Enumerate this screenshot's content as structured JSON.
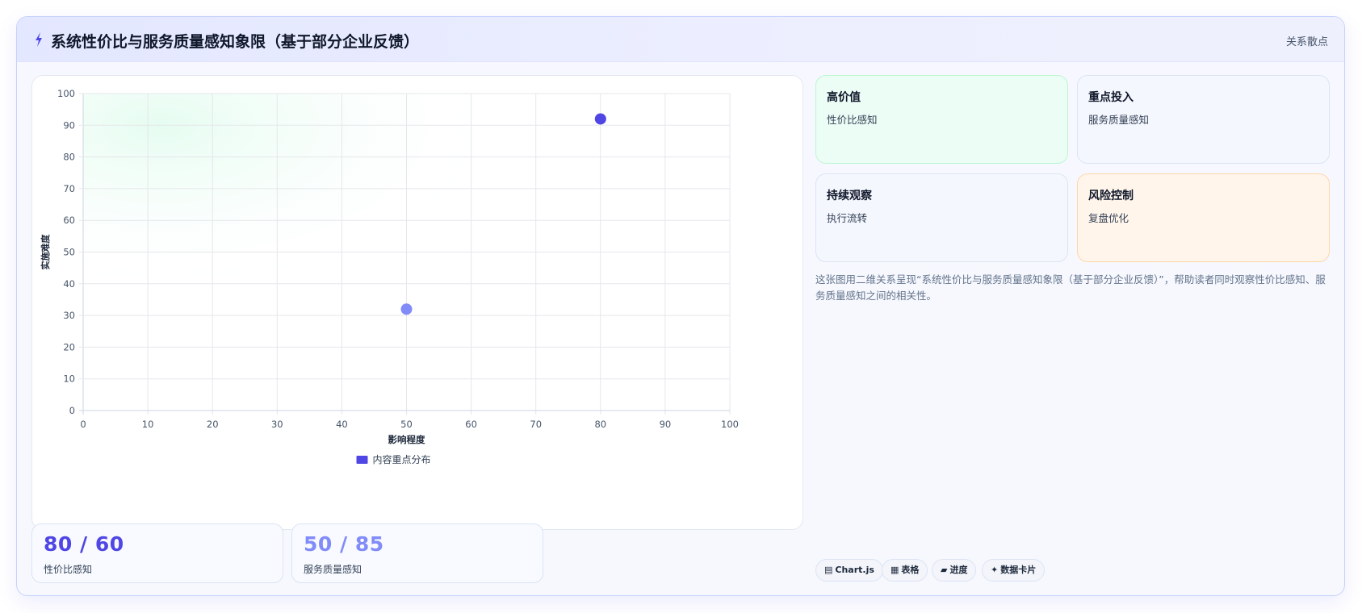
{
  "header": {
    "title": "系统性价比与服务质量感知象限（基于部分企业反馈）",
    "tag": "关系散点"
  },
  "chart_data": {
    "type": "scatter",
    "xlabel": "影响程度",
    "ylabel": "实施难度",
    "xlim": [
      0,
      100
    ],
    "ylim": [
      0,
      100
    ],
    "x_ticks": [
      "0",
      "10",
      "20",
      "30",
      "40",
      "50",
      "60",
      "70",
      "80",
      "90",
      "100"
    ],
    "y_ticks": [
      "0",
      "10",
      "20",
      "30",
      "40",
      "50",
      "60",
      "70",
      "80",
      "90",
      "100"
    ],
    "grid": true,
    "legend": "bottom",
    "series": [
      {
        "name": "内容重点分布",
        "color": "#4f46e5",
        "points": [
          {
            "x": 80,
            "y": 92,
            "color": "#4f46e5"
          },
          {
            "x": 50,
            "y": 32,
            "color": "#818cf8"
          }
        ]
      }
    ]
  },
  "kpis": [
    {
      "value": "80 / 60",
      "label": "性价比感知",
      "color": "#4f46e5"
    },
    {
      "value": "50 / 85",
      "label": "服务质量感知",
      "color": "#818cf8"
    }
  ],
  "quadrants": [
    {
      "title": "高价值",
      "subtitle": "性价比感知",
      "color": "#ecfdf5"
    },
    {
      "title": "重点投入",
      "subtitle": "服务质量感知",
      "color": "#f5f7fe"
    },
    {
      "title": "持续观察",
      "subtitle": "执行流转",
      "color": "#f5f7fe"
    },
    {
      "title": "风险控制",
      "subtitle": "复盘优化",
      "color": "#fff5eb"
    }
  ],
  "description": "这张图用二维关系呈现“系统性价比与服务质量感知象限（基于部分企业反馈）”，帮助读者同时观察性价比感知、服务质量感知之间的相关性。",
  "chips": [
    {
      "icon": "chart-icon",
      "glyph": "▤",
      "label": "Chart.js"
    },
    {
      "icon": "table-icon",
      "glyph": "▦",
      "label": "表格"
    },
    {
      "icon": "progress-icon",
      "glyph": "▰",
      "label": "进度"
    },
    {
      "icon": "sparkle-icon",
      "glyph": "✦",
      "label": "数据卡片"
    }
  ],
  "accent": "#4f46e5"
}
